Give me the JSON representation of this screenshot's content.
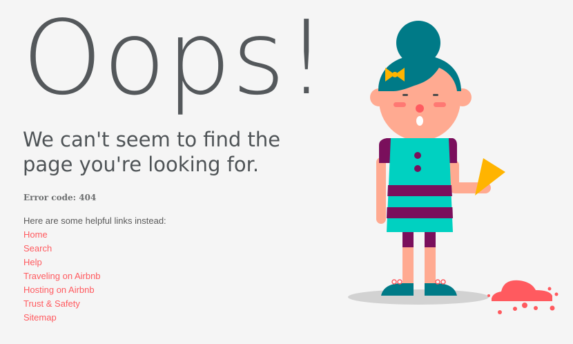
{
  "heading": "Oops!",
  "subtitle": {
    "line1": "We can't seem to find the",
    "line2": "page you're looking for."
  },
  "error_code": "Error code: 404",
  "helpful_text": "Here are some helpful links instead:",
  "links": [
    {
      "label": "Home"
    },
    {
      "label": "Search"
    },
    {
      "label": "Help"
    },
    {
      "label": "Traveling on Airbnb"
    },
    {
      "label": "Hosting on Airbnb"
    },
    {
      "label": "Trust & Safety"
    },
    {
      "label": "Sitemap"
    }
  ],
  "colors": {
    "background": "#f5f5f5",
    "heading": "#54585b",
    "link": "#ff5a5f",
    "hair": "#007a87",
    "dress": "#00d1c1",
    "stripe": "#7a0f5c",
    "skin": "#ffaa91",
    "ice_cream": "#ff5a5f",
    "cone": "#ffb400"
  },
  "illustration": {
    "icon": "girl-dropped-ice-cream-illustration"
  }
}
